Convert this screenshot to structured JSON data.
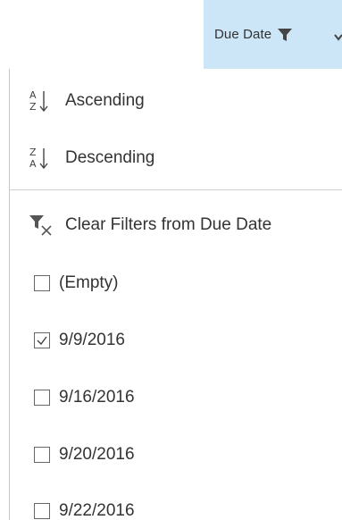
{
  "header": {
    "column_label": "Due Date"
  },
  "menu": {
    "sort": [
      {
        "label": "Ascending",
        "icon": "sort-ascending-icon",
        "top_letter": "A",
        "bottom_letter": "Z"
      },
      {
        "label": "Descending",
        "icon": "sort-descending-icon",
        "top_letter": "Z",
        "bottom_letter": "A"
      }
    ],
    "clear_filter": {
      "label": "Clear Filters from Due Date",
      "icon": "clear-filter-icon"
    },
    "values": [
      {
        "label": "(Empty)",
        "checked": false
      },
      {
        "label": "9/9/2016",
        "checked": true
      },
      {
        "label": "9/16/2016",
        "checked": false
      },
      {
        "label": "9/20/2016",
        "checked": false
      },
      {
        "label": "9/22/2016",
        "checked": false
      }
    ]
  },
  "colors": {
    "header_bg": "#cde6f7",
    "text": "#333333",
    "icon": "#444444",
    "divider": "#d0d0d0"
  }
}
